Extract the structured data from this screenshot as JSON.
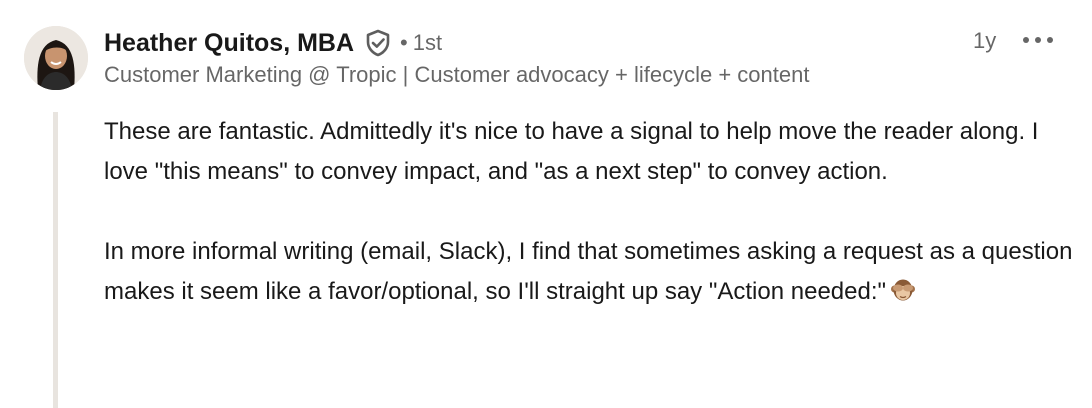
{
  "comment": {
    "author": {
      "name": "Heather Quitos, MBA",
      "degree": "1st",
      "separator": "•",
      "headline": "Customer Marketing @ Tropic | Customer advocacy + lifecycle + content",
      "avatar_icon": "profile-photo",
      "verified_icon": "verified-shield-icon"
    },
    "timestamp": "1y",
    "more_icon": "more-options-ellipsis-icon",
    "paragraphs": [
      "These are fantastic. Admittedly it's nice to have a signal to help move the reader along. I love \"this means\" to convey impact, and \"as a next step\" to convey action.",
      "In more informal writing (email, Slack), I find that sometimes asking a request as a question makes it seem like a favor/optional, so I'll straight up say \"Action needed:\""
    ],
    "trailing_emoji": "see-no-evil-monkey-emoji"
  },
  "colors": {
    "primary_text": "#1f1f1f",
    "secondary_text": "#666666",
    "thread_line": "#e8e4df",
    "background": "#ffffff"
  }
}
